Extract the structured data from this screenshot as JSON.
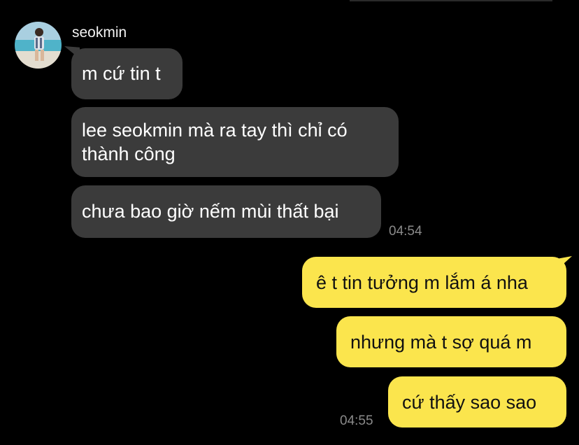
{
  "sender": {
    "name": "seokmin"
  },
  "incoming": [
    {
      "text": "m cứ tin t"
    },
    {
      "text_line1": "lee seokmin mà ra tay thì chỉ có",
      "text_line2": "thành công"
    },
    {
      "text": "chưa bao giờ nếm mùi thất bại"
    }
  ],
  "incoming_time": "04:54",
  "outgoing": [
    {
      "text": "ê t tin tưởng m lắm á nha"
    },
    {
      "text": "nhưng mà t sợ quá m"
    },
    {
      "text": "cứ thấy sao sao"
    }
  ],
  "outgoing_time": "04:55",
  "colors": {
    "background": "#000000",
    "incoming_bubble": "#3b3b3b",
    "outgoing_bubble": "#fbe54d",
    "timestamp": "#8a8a8a"
  }
}
